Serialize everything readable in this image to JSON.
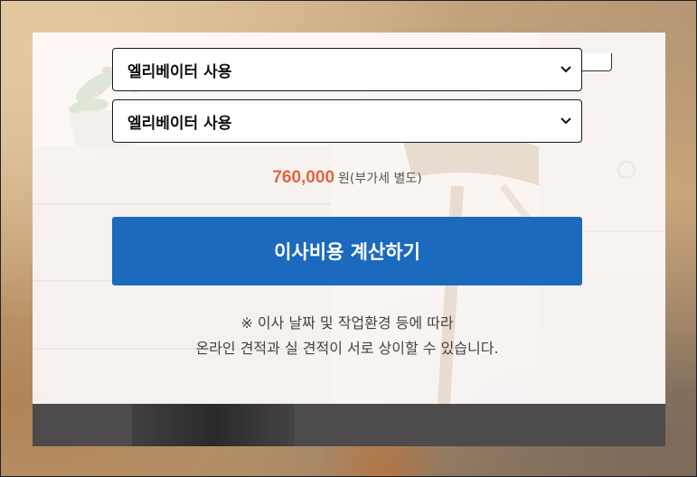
{
  "form": {
    "selects": [
      {
        "value": "엘리베이터 사용"
      },
      {
        "value": "엘리베이터 사용"
      }
    ]
  },
  "price": {
    "amount": "760,000",
    "unit_note": "원(부가세 별도)",
    "accent_color": "#e2673d"
  },
  "actions": {
    "calculate_label": "이사비용 계산하기",
    "button_color": "#1b6abd"
  },
  "notice": {
    "line1": "※ 이사 날짜 및 작업환경 등에 따라",
    "line2": "온라인 견적과 실 견적이 서로 상이할 수 있습니다."
  },
  "icons": {
    "select_arrow": "chevron-down-icon"
  }
}
